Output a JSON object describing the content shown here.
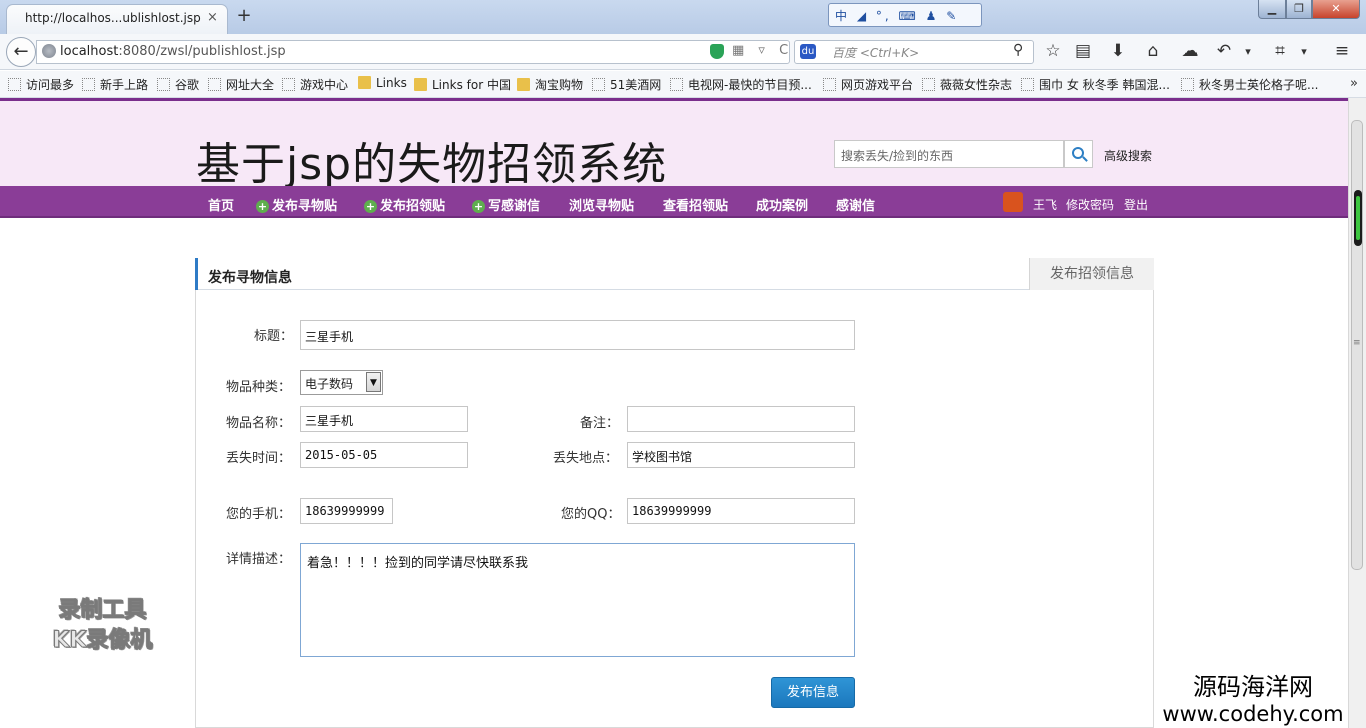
{
  "browser": {
    "tab_title": "http://localhos...ublishlost.jsp",
    "tab_close": "×",
    "new_tab": "+",
    "ime_bar": "中 ◢ °, ⌨ ♟ ✎",
    "url_host": "localhost",
    "url_rest": ":8080/zwsl/publishlost.jsp",
    "search_engine_label": "百度 <Ctrl+K>",
    "url_icons": "▦ ▿ C",
    "window_min": "▁",
    "window_max": "❐",
    "window_close": "✕",
    "toolbar_icons": [
      "☆",
      "▤",
      "⬇",
      "⌂",
      "☁",
      "↶",
      "▾",
      "⌗",
      "▾",
      "≡"
    ],
    "bookmarks": [
      {
        "label": "访问最多",
        "icon": "page"
      },
      {
        "label": "新手上路",
        "icon": "page"
      },
      {
        "label": "谷歌",
        "icon": "page"
      },
      {
        "label": "网址大全",
        "icon": "page"
      },
      {
        "label": "游戏中心",
        "icon": "page"
      },
      {
        "label": "Links",
        "icon": "folder"
      },
      {
        "label": "Links for 中国",
        "icon": "folder"
      },
      {
        "label": "淘宝购物",
        "icon": "folder"
      },
      {
        "label": "51美酒网",
        "icon": "page"
      },
      {
        "label": "电视网-最快的节目预...",
        "icon": "page"
      },
      {
        "label": "网页游戏平台",
        "icon": "page"
      },
      {
        "label": "薇薇女性杂志",
        "icon": "page"
      },
      {
        "label": "围巾 女 秋冬季 韩国混...",
        "icon": "page"
      },
      {
        "label": "秋冬男士英伦格子呢...",
        "icon": "page"
      }
    ],
    "bookmarks_more": "»"
  },
  "site": {
    "title": "基于jsp的失物招领系统",
    "search_placeholder": "搜索丢失/捡到的东西",
    "advanced_search": "高级搜索",
    "menu": [
      {
        "label": "首页",
        "plus": false
      },
      {
        "label": "发布寻物贴",
        "plus": true
      },
      {
        "label": "发布招领贴",
        "plus": true
      },
      {
        "label": "写感谢信",
        "plus": true
      },
      {
        "label": "浏览寻物贴",
        "plus": false
      },
      {
        "label": "查看招领贴",
        "plus": false
      },
      {
        "label": "成功案例",
        "plus": false
      },
      {
        "label": "感谢信",
        "plus": false
      }
    ],
    "user_name": "王飞",
    "change_password": "修改密码",
    "logout": "登出"
  },
  "form": {
    "title": "发布寻物信息",
    "other_tab": "发布招领信息",
    "labels": {
      "title": "标题：",
      "category": "物品种类：",
      "item_name": "物品名称：",
      "remark": "备注：",
      "lost_time": "丢失时间：",
      "lost_place": "丢失地点：",
      "phone": "您的手机：",
      "qq": "您的QQ：",
      "description": "详情描述："
    },
    "values": {
      "title": "三星手机",
      "category": "电子数码",
      "item_name": "三星手机",
      "remark": "",
      "lost_time": "2015-05-05",
      "lost_place": "学校图书馆",
      "phone": "18639999999",
      "qq": "18639999999",
      "description": "着急！！！！捡到的同学请尽快联系我"
    },
    "submit": "发布信息"
  },
  "watermarks": {
    "recorder_line1": "录制工具",
    "recorder_line2": "KK录像机",
    "site_cn": "源码海洋网",
    "site_url": "www.codehy.com"
  }
}
